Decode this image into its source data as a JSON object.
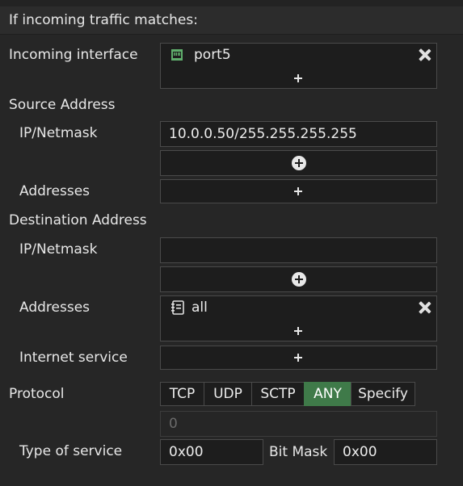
{
  "section_title": "If incoming traffic matches:",
  "incoming_interface": {
    "label": "Incoming interface",
    "value": "port5",
    "icon": "port-icon"
  },
  "source": {
    "heading": "Source Address",
    "ip_label": "IP/Netmask",
    "ip_value": "10.0.0.50/255.255.255.255",
    "addresses_label": "Addresses"
  },
  "destination": {
    "heading": "Destination Address",
    "ip_label": "IP/Netmask",
    "ip_value": "",
    "addresses_label": "Addresses",
    "addresses_value": "all",
    "internet_service_label": "Internet service"
  },
  "protocol": {
    "label": "Protocol",
    "options": [
      "TCP",
      "UDP",
      "SCTP",
      "ANY",
      "Specify"
    ],
    "selected": "ANY",
    "number_placeholder": "0"
  },
  "tos": {
    "label": "Type of service",
    "value": "0x00",
    "bitmask_label": "Bit Mask",
    "bitmask_value": "0x00"
  },
  "colors": {
    "background": "#262626",
    "active": "#3f7a49"
  }
}
